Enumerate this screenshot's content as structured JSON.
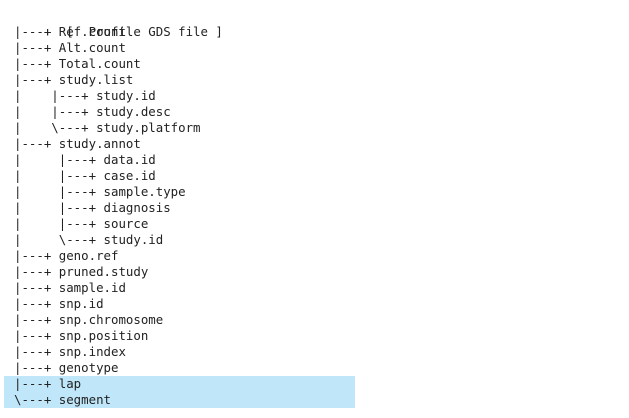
{
  "tree": {
    "header": "+  [  Profile GDS file ]",
    "lines": [
      {
        "prefix": "|---+ ",
        "label": "Ref.count",
        "selected": false
      },
      {
        "prefix": "|---+ ",
        "label": "Alt.count",
        "selected": false
      },
      {
        "prefix": "|---+ ",
        "label": "Total.count",
        "selected": false
      },
      {
        "prefix": "|---+ ",
        "label": "study.list",
        "selected": false
      },
      {
        "prefix": "|    |---+ ",
        "label": "study.id",
        "selected": false
      },
      {
        "prefix": "|    |---+ ",
        "label": "study.desc",
        "selected": false
      },
      {
        "prefix": "|    \\---+ ",
        "label": "study.platform",
        "selected": false
      },
      {
        "prefix": "|---+ ",
        "label": "study.annot",
        "selected": false
      },
      {
        "prefix": "|     |---+ ",
        "label": "data.id",
        "selected": false
      },
      {
        "prefix": "|     |---+ ",
        "label": "case.id",
        "selected": false
      },
      {
        "prefix": "|     |---+ ",
        "label": "sample.type",
        "selected": false
      },
      {
        "prefix": "|     |---+ ",
        "label": "diagnosis",
        "selected": false
      },
      {
        "prefix": "|     |---+ ",
        "label": "source",
        "selected": false
      },
      {
        "prefix": "|     \\---+ ",
        "label": "study.id",
        "selected": false
      },
      {
        "prefix": "|---+ ",
        "label": "geno.ref",
        "selected": false
      },
      {
        "prefix": "|---+ ",
        "label": "pruned.study",
        "selected": false
      },
      {
        "prefix": "|---+ ",
        "label": "sample.id",
        "selected": false
      },
      {
        "prefix": "|---+ ",
        "label": "snp.id",
        "selected": false
      },
      {
        "prefix": "|---+ ",
        "label": "snp.chromosome",
        "selected": false
      },
      {
        "prefix": "|---+ ",
        "label": "snp.position",
        "selected": false
      },
      {
        "prefix": "|---+ ",
        "label": "snp.index",
        "selected": false
      },
      {
        "prefix": "|---+ ",
        "label": "genotype",
        "selected": false
      },
      {
        "prefix": "|---+ ",
        "label": "lap",
        "selected": true
      },
      {
        "prefix": "\\---+ ",
        "label": "segment",
        "selected": true
      }
    ]
  },
  "colors": {
    "selection": "#bfe6f9",
    "text": "#222222",
    "background": "#ffffff"
  }
}
